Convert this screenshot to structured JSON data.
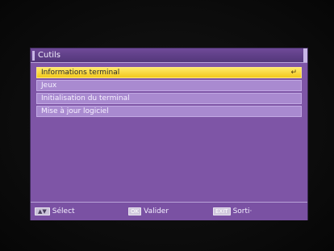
{
  "window": {
    "title": "Cutils"
  },
  "menu": {
    "items": [
      {
        "label": "Informations terminal",
        "selected": true,
        "icon": "enter-icon"
      },
      {
        "label": "Jeux",
        "selected": false
      },
      {
        "label": "Initialisation du terminal",
        "selected": false
      },
      {
        "label": "Mise à jour logiciel",
        "selected": false
      }
    ],
    "enter_glyph": "↵"
  },
  "footer": {
    "select": {
      "key": "▲▼",
      "label": "Sélect"
    },
    "ok": {
      "key": "OK",
      "label": "Valider"
    },
    "exit": {
      "key": "EXIT",
      "label": "Sorti·"
    }
  },
  "colors": {
    "window_bg": "#7e55a6",
    "item_bg": "#a98ad0",
    "selected_bg": "#f2c81c"
  }
}
